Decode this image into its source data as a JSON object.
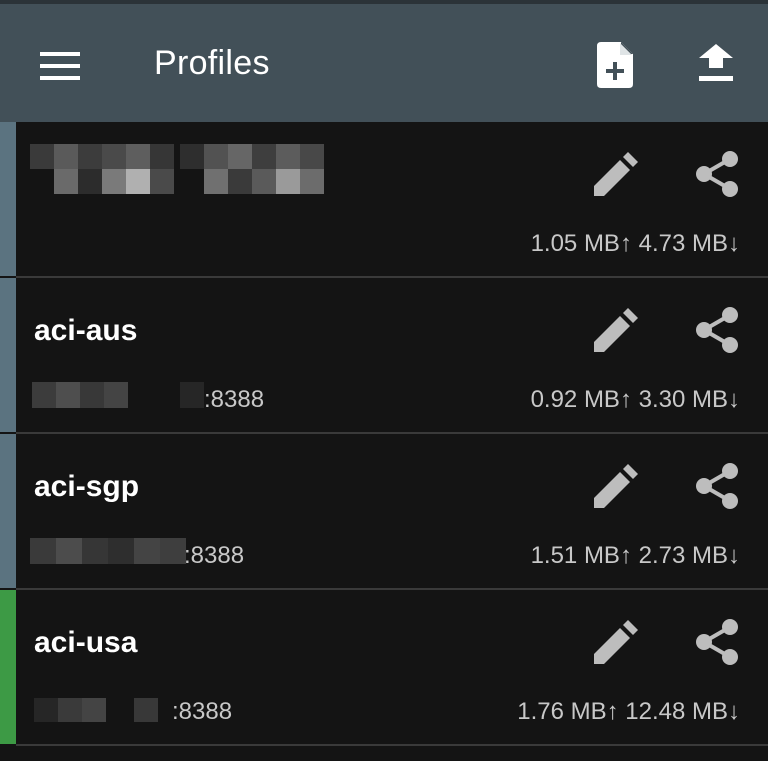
{
  "toolbar": {
    "title": "Profiles",
    "icons": {
      "menu": "menu-icon",
      "add": "add-file-icon",
      "upload": "upload-icon"
    },
    "background": "#425058"
  },
  "profiles": [
    {
      "name": "",
      "address": "",
      "traffic": "1.05 MB↑ 4.73 MB↓",
      "stripe_color": "#5b7380",
      "active": false
    },
    {
      "name": "aci-aus",
      "address": ":8388",
      "traffic": "0.92 MB↑ 3.30 MB↓",
      "stripe_color": "#5b7380",
      "active": false
    },
    {
      "name": "aci-sgp",
      "address": ":8388",
      "traffic": "1.51 MB↑ 2.73 MB↓",
      "stripe_color": "#5b7380",
      "active": false
    },
    {
      "name": "aci-usa",
      "address": ":8388",
      "traffic": "1.76 MB↑ 12.48 MB↓",
      "stripe_color": "#3d9a45",
      "active": true
    }
  ]
}
